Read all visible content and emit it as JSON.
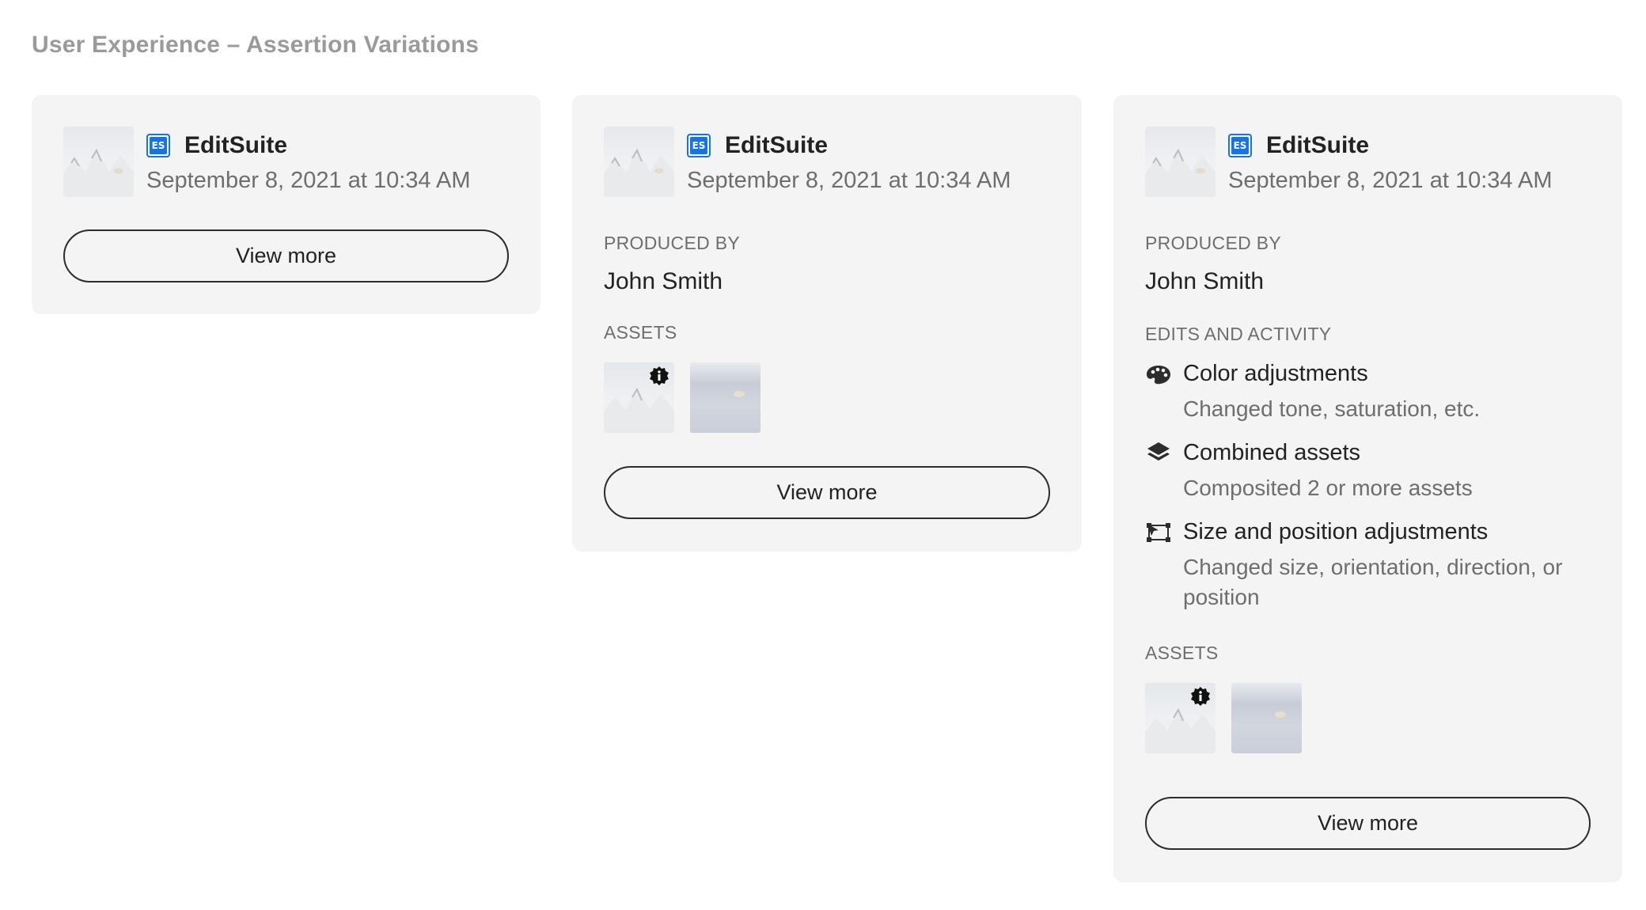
{
  "page": {
    "title": "User Experience – Assertion Variations"
  },
  "cards": [
    {
      "app_icon_text": "ES",
      "app_name": "EditSuite",
      "date": "September 8, 2021 at 10:34 AM",
      "view_more": "View more"
    },
    {
      "app_icon_text": "ES",
      "app_name": "EditSuite",
      "date": "September 8, 2021 at 10:34 AM",
      "produced_by_label": "PRODUCED BY",
      "produced_by": "John Smith",
      "assets_label": "ASSETS",
      "view_more": "View more"
    },
    {
      "app_icon_text": "ES",
      "app_name": "EditSuite",
      "date": "September 8, 2021 at 10:34 AM",
      "produced_by_label": "PRODUCED BY",
      "produced_by": "John Smith",
      "edits_label": "EDITS AND ACTIVITY",
      "edits": [
        {
          "icon": "palette-icon",
          "title": "Color adjustments",
          "desc": "Changed tone, saturation, etc."
        },
        {
          "icon": "layers-icon",
          "title": "Combined assets",
          "desc": "Composited 2 or more assets"
        },
        {
          "icon": "transform-icon",
          "title": "Size and position adjustments",
          "desc": "Changed size, orientation, direction, or position"
        }
      ],
      "assets_label": "ASSETS",
      "view_more": "View more"
    }
  ],
  "colors": {
    "accent": "#1473e6",
    "card_bg": "#f4f4f4",
    "muted_text": "#6e6e6e"
  }
}
